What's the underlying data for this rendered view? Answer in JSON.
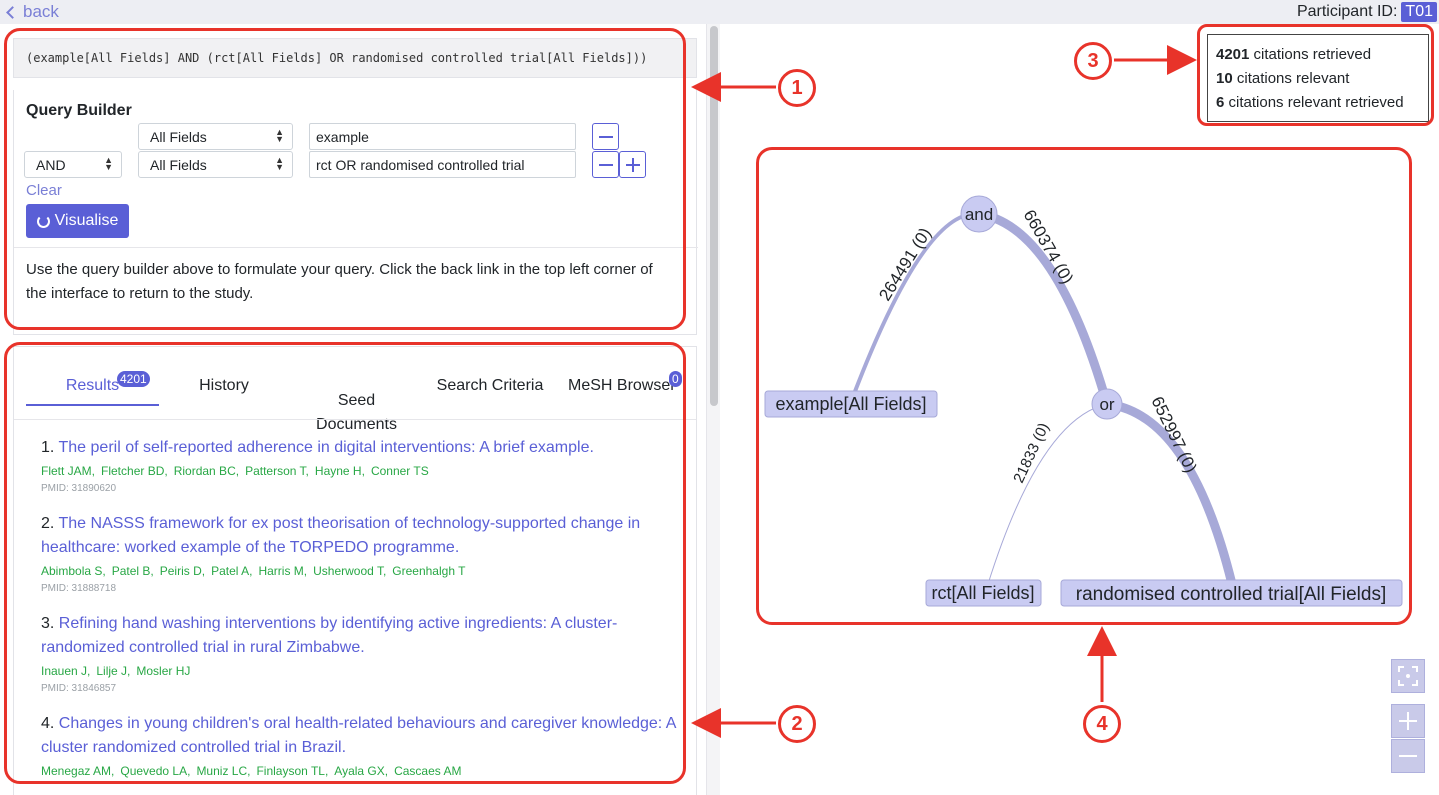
{
  "topbar": {
    "back_label": "back",
    "participant_label": "Participant ID:",
    "participant_id": "T01"
  },
  "query_string": "(example[All Fields] AND (rct[All Fields] OR randomised controlled trial[All Fields]))",
  "query_builder": {
    "title": "Query Builder",
    "rows": [
      {
        "operator": "",
        "field": "All Fields",
        "term": "example"
      },
      {
        "operator": "AND",
        "field": "All Fields",
        "term": "rct OR randomised controlled trial"
      }
    ],
    "clear_label": "Clear",
    "visualise_label": "Visualise",
    "help_text": "Use the query builder above to formulate your query. Click the back link in the top left corner of the interface to return to the study."
  },
  "tabs": [
    {
      "label": "Results",
      "badge": "4201"
    },
    {
      "label": "History"
    },
    {
      "label": "Seed\nDocuments"
    },
    {
      "label": "Search Criteria"
    },
    {
      "label": "MeSH Browser",
      "badge": "0"
    }
  ],
  "results": [
    {
      "num": "1.",
      "title": "The peril of self-reported adherence in digital interventions: A brief example.",
      "authors": [
        "Flett JAM,",
        "Fletcher BD,",
        "Riordan BC,",
        "Patterson T,",
        "Hayne H,",
        "Conner TS"
      ],
      "pmid": "PMID: 31890620"
    },
    {
      "num": "2.",
      "title": "The NASSS framework for ex post theorisation of technology-supported change in healthcare: worked example of the TORPEDO programme.",
      "authors": [
        "Abimbola S,",
        "Patel B,",
        "Peiris D,",
        "Patel A,",
        "Harris M,",
        "Usherwood T,",
        "Greenhalgh T"
      ],
      "pmid": "PMID: 31888718"
    },
    {
      "num": "3.",
      "title": "Refining hand washing interventions by identifying active ingredients: A cluster-randomized controlled trial in rural Zimbabwe.",
      "authors": [
        "Inauen J,",
        "Lilje J,",
        "Mosler HJ"
      ],
      "pmid": "PMID: 31846857"
    },
    {
      "num": "4.",
      "title": "Changes in young children's oral health-related behaviours and caregiver knowledge: A cluster randomized controlled trial in Brazil.",
      "authors": [
        "Menegaz AM,",
        "Quevedo LA,",
        "Muniz LC,",
        "Finlayson TL,",
        "Ayala GX,",
        "Cascaes AM"
      ],
      "pmid": ""
    }
  ],
  "stats": {
    "retrieved_count": "4201",
    "retrieved_label": "citations retrieved",
    "relevant_count": "10",
    "relevant_label": "citations relevant",
    "relevant_retrieved_count": "6",
    "relevant_retrieved_label": "citations relevant retrieved"
  },
  "tree": {
    "nodes": {
      "and": "and",
      "or": "or",
      "example": "example[All Fields]",
      "rct": "rct[All Fields]",
      "rand": "randomised controlled trial[All Fields]"
    },
    "edges": {
      "and_example": "264491 (0)",
      "and_or": "660374 (0)",
      "or_rct": "21833 (0)",
      "or_rand": "652997 (0)"
    }
  },
  "annotations": [
    "1",
    "2",
    "3",
    "4"
  ],
  "colors": {
    "accent": "#5a5fd6",
    "author_green": "#28a745",
    "annotation_red": "#e8332a",
    "node_fill": "#c9cbf2"
  }
}
